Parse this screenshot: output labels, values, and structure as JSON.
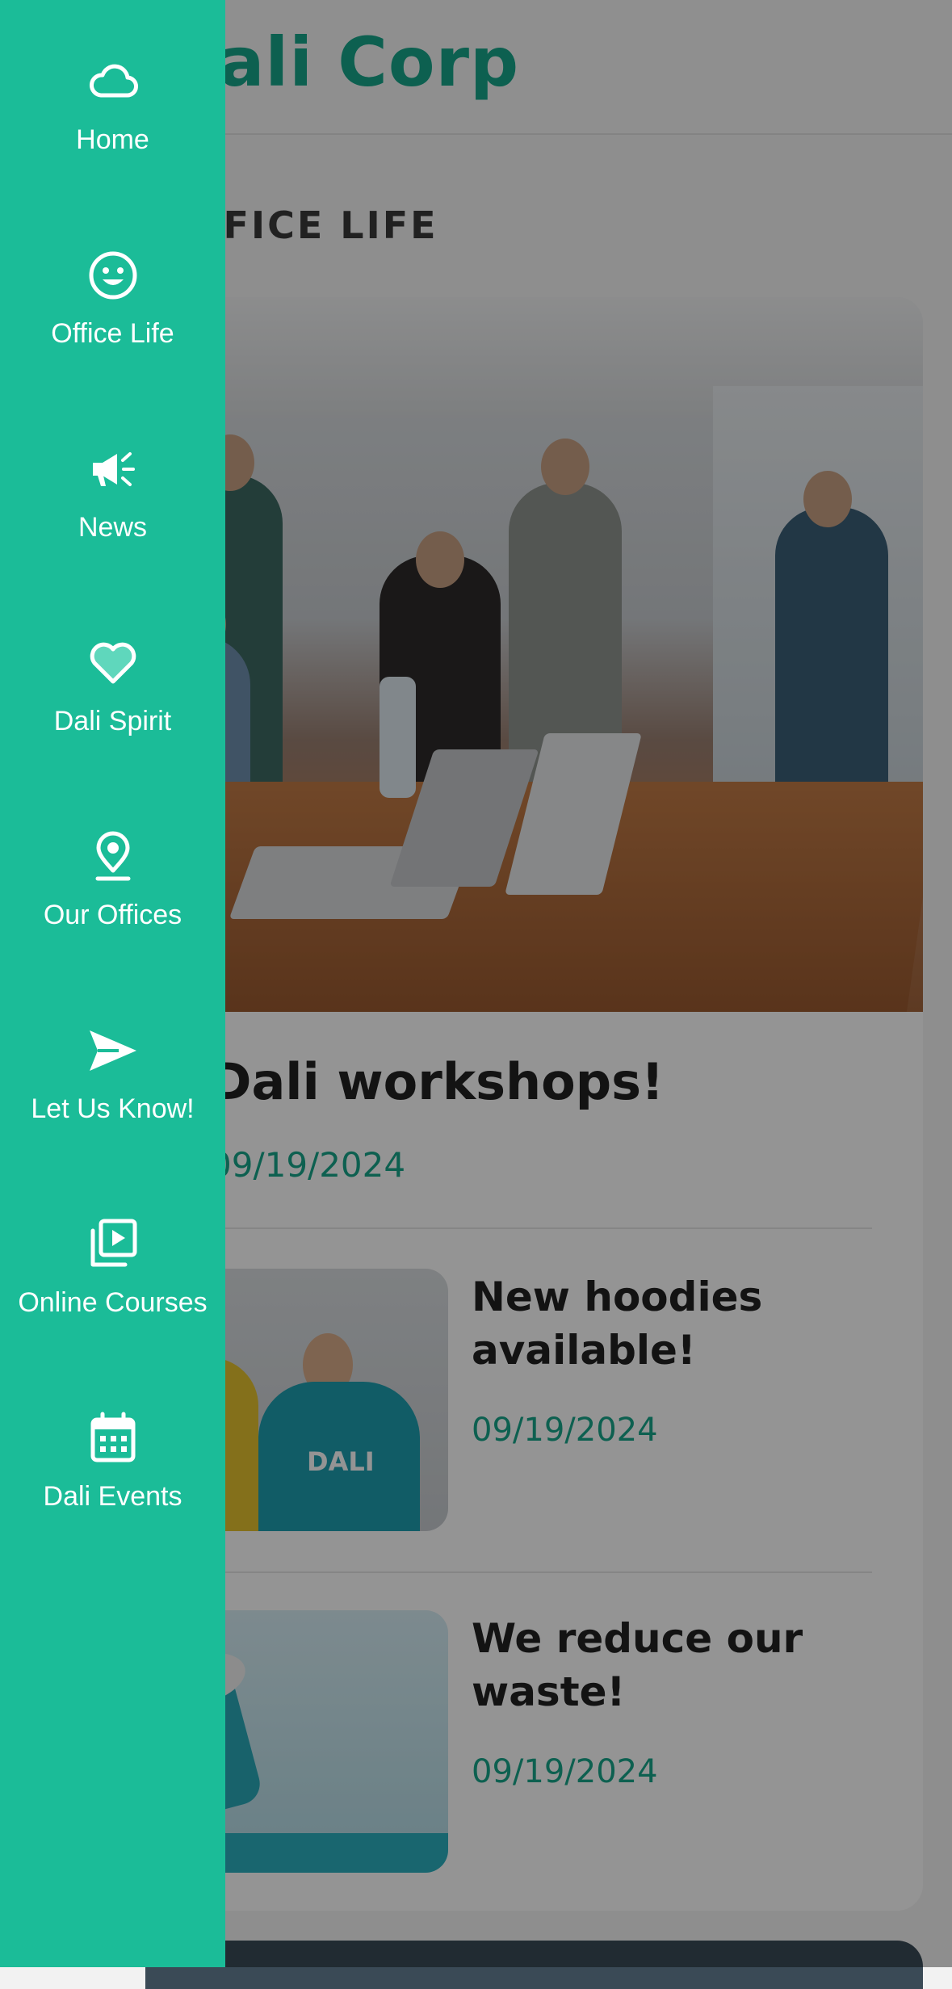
{
  "header": {
    "title": "Dali Corp"
  },
  "section": {
    "label": "OFFICE LIFE"
  },
  "feature": {
    "title": "Dali workshops!",
    "date": "09/19/2024"
  },
  "articles": [
    {
      "title": "New hoodies available!",
      "date": "09/19/2024",
      "thumb_text": "DALI"
    },
    {
      "title": "We reduce our waste!",
      "date": "09/19/2024"
    }
  ],
  "drawer": {
    "background_color": "#1bbc98",
    "items": [
      {
        "label": "Home",
        "icon": "cloud-icon"
      },
      {
        "label": "Office Life",
        "icon": "smiley-icon"
      },
      {
        "label": "News",
        "icon": "megaphone-icon"
      },
      {
        "label": "Dali Spirit",
        "icon": "heart-icon"
      },
      {
        "label": "Our Offices",
        "icon": "location-pin-icon"
      },
      {
        "label": "Let Us Know!",
        "icon": "paper-plane-icon"
      },
      {
        "label": "Online Courses",
        "icon": "video-library-icon"
      },
      {
        "label": "Dali Events",
        "icon": "calendar-icon"
      }
    ]
  },
  "colors": {
    "accent": "#17a68a",
    "overlay": "rgba(0,0,0,0.42)"
  }
}
